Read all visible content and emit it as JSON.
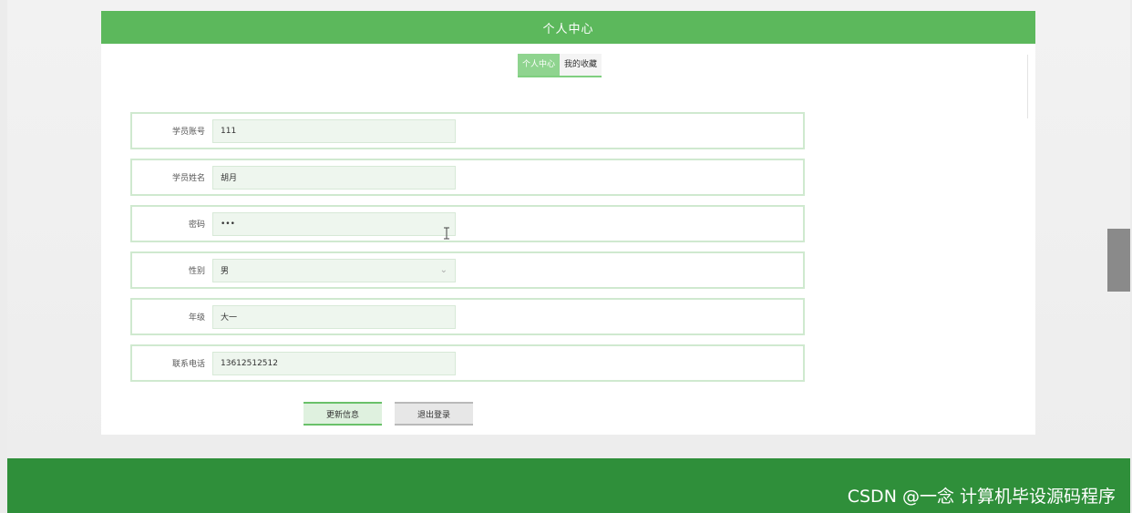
{
  "header": {
    "title": "个人中心"
  },
  "tabs": [
    {
      "label": "个人中心",
      "active": true
    },
    {
      "label": "我的收藏",
      "active": false
    }
  ],
  "form": {
    "fields": [
      {
        "label": "学员账号",
        "value": "111"
      },
      {
        "label": "学员姓名",
        "value": "胡月"
      },
      {
        "label": "密码",
        "value": "•••"
      },
      {
        "label": "性别",
        "value": "男",
        "type": "select"
      },
      {
        "label": "年级",
        "value": "大一"
      },
      {
        "label": "联系电话",
        "value": "13612512512"
      }
    ]
  },
  "actions": {
    "update_label": "更新信息",
    "logout_label": "退出登录"
  },
  "watermark": {
    "text": "CSDN @一念 计算机毕设源码程序"
  },
  "colors": {
    "header_green": "#5cb85c",
    "footer_green": "#2f8f3a",
    "field_bg": "#eef6ee"
  }
}
